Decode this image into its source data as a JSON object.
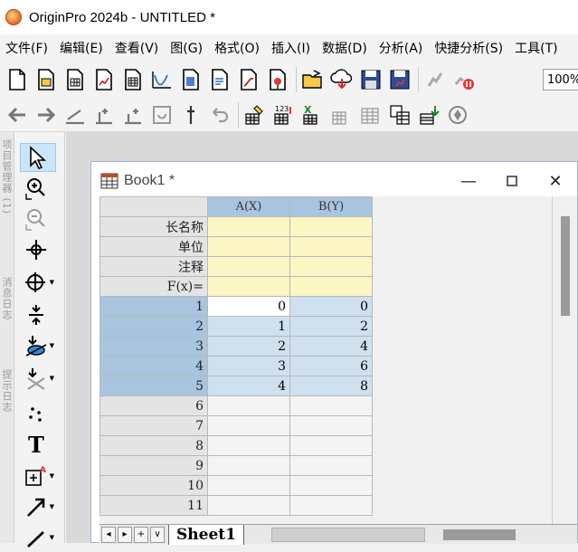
{
  "window": {
    "title": "OriginPro 2024b - UNTITLED *"
  },
  "menu": [
    "文件(F)",
    "编辑(E)",
    "查看(V)",
    "图(G)",
    "格式(O)",
    "插入(I)",
    "数据(D)",
    "分析(A)",
    "快捷分析(S)",
    "工具(T)"
  ],
  "toolbar": {
    "zoom": "100%"
  },
  "side_tabs": [
    "项目管理器 (1)",
    "消息日志",
    "提示日志"
  ],
  "book": {
    "title": "Book1 *",
    "columns": [
      "A(X)",
      "B(Y)"
    ],
    "meta_rows": [
      "长名称",
      "单位",
      "注释",
      "F(x)="
    ],
    "rows": [
      {
        "n": "1",
        "a": "0",
        "b": "0"
      },
      {
        "n": "2",
        "a": "1",
        "b": "2"
      },
      {
        "n": "3",
        "a": "2",
        "b": "4"
      },
      {
        "n": "4",
        "a": "3",
        "b": "6"
      },
      {
        "n": "5",
        "a": "4",
        "b": "8"
      },
      {
        "n": "6",
        "a": "",
        "b": ""
      },
      {
        "n": "7",
        "a": "",
        "b": ""
      },
      {
        "n": "8",
        "a": "",
        "b": ""
      },
      {
        "n": "9",
        "a": "",
        "b": ""
      },
      {
        "n": "10",
        "a": "",
        "b": ""
      },
      {
        "n": "11",
        "a": "",
        "b": ""
      }
    ],
    "sheet_tab": "Sheet1",
    "sheet_nav": [
      "◂",
      "▸",
      "+",
      "∨"
    ]
  },
  "colors": {
    "selection": "#cfe0ef",
    "header": "#a9c4de",
    "meta": "#fbf6c3"
  }
}
